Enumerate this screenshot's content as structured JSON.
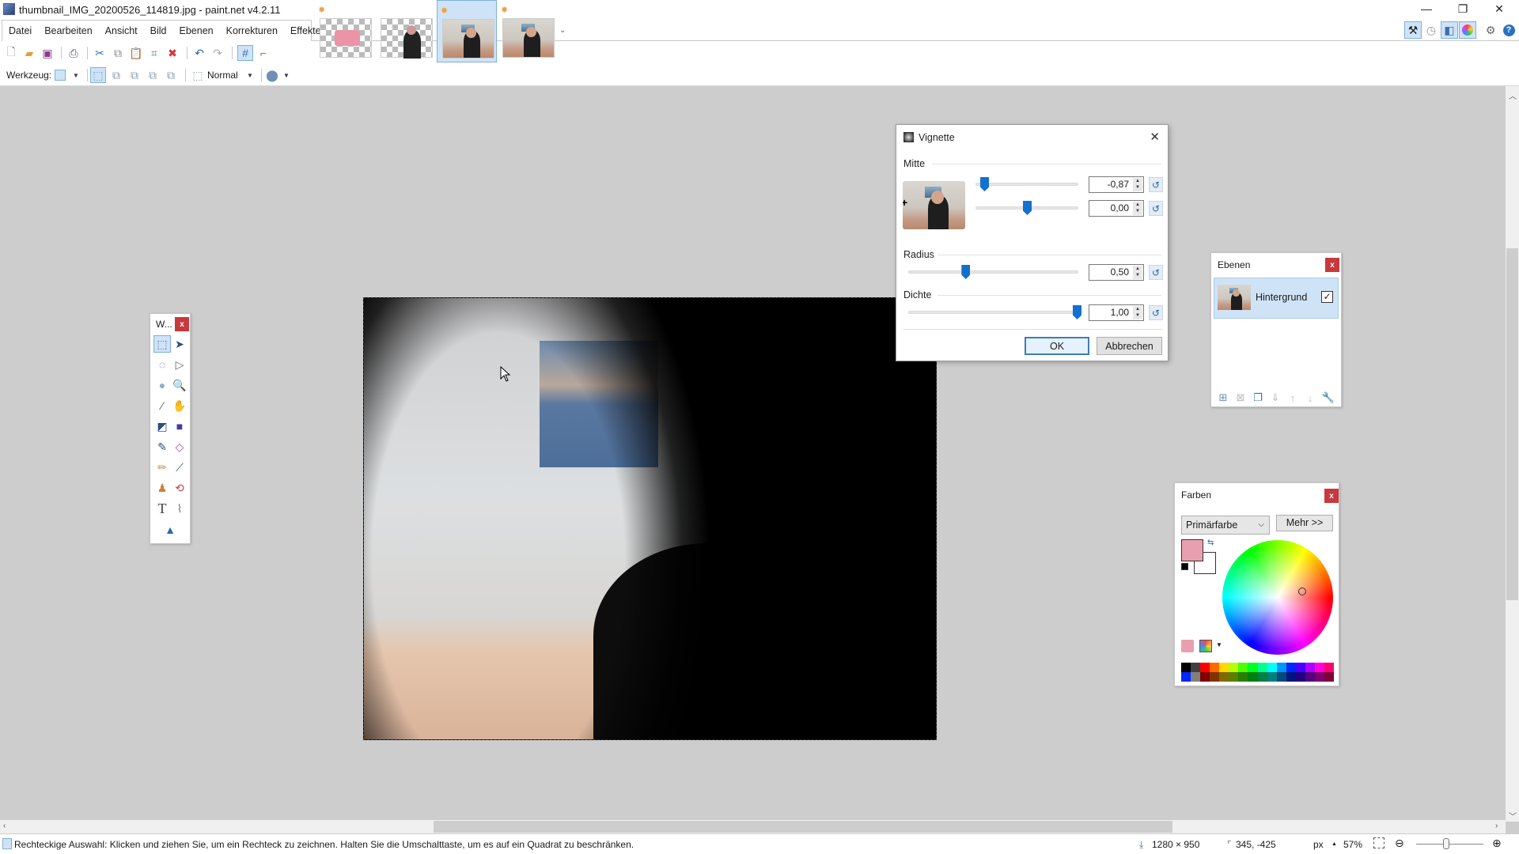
{
  "window": {
    "title": "thumbnail_IMG_20200526_114819.jpg - paint.net v4.2.11",
    "minimize_glyph": "—",
    "maximize_glyph": "❐",
    "close_glyph": "✕"
  },
  "menu": [
    "Datei",
    "Bearbeiten",
    "Ansicht",
    "Bild",
    "Ebenen",
    "Korrekturen",
    "Effekte"
  ],
  "image_tabs": [
    {
      "label": "pink rectangle image",
      "modified": true,
      "active": false
    },
    {
      "label": "person transparent image",
      "modified": false,
      "active": false
    },
    {
      "label": "thumbnail_IMG_20200526_114819.jpg",
      "modified": true,
      "active": true
    },
    {
      "label": "photo image",
      "modified": true,
      "active": false
    }
  ],
  "top_right_icons": [
    "tools-icon",
    "history-icon",
    "layers-icon",
    "colors-icon",
    "settings-icon",
    "help-icon"
  ],
  "toolbar": {
    "tool_label": "Werkzeug:",
    "blend_mode": "Normal"
  },
  "tools_window": {
    "title": "W...",
    "close": "x"
  },
  "vignette": {
    "title": "Vignette",
    "close": "✕",
    "sections": {
      "center": "Mitte",
      "radius": "Radius",
      "density": "Dichte"
    },
    "center_x": {
      "value": "-0,87",
      "fraction": 0.065
    },
    "center_y": {
      "value": "0,00",
      "fraction": 0.5
    },
    "radius": {
      "value": "0,50",
      "fraction": 0.33
    },
    "density": {
      "value": "1,00",
      "fraction": 1.0
    },
    "ok": "OK",
    "cancel": "Abbrechen"
  },
  "layers": {
    "title": "Ebenen",
    "close": "x",
    "items": [
      {
        "name": "Hintergrund",
        "visible": true,
        "check": "✓"
      }
    ]
  },
  "colors": {
    "title": "Farben",
    "close": "x",
    "selector": "Primärfarbe",
    "more": "Mehr >>",
    "primary": "#e8a0b0",
    "secondary": "#ffffff",
    "palette_top": [
      "#000000",
      "#404040",
      "#ff0000",
      "#ff6a00",
      "#ffd800",
      "#b6ff00",
      "#4cff00",
      "#00ff21",
      "#00ff90",
      "#00ffff",
      "#0094ff",
      "#0026ff",
      "#4800ff",
      "#b200ff",
      "#ff00dc",
      "#ff006e"
    ],
    "palette_bottom": [
      "#0026ff",
      "#808080",
      "#7f0000",
      "#7f3300",
      "#7f6a00",
      "#5b7f00",
      "#267f00",
      "#007f0e",
      "#007f46",
      "#007f7f",
      "#004a7f",
      "#00137f",
      "#21007f",
      "#57007f",
      "#7f006e",
      "#7f0037"
    ]
  },
  "statusbar": {
    "hint": "Rechteckige Auswahl: Klicken und ziehen Sie, um ein Rechteck zu zeichnen. Halten Sie die Umschalttaste, um es auf ein Quadrat zu beschränken.",
    "image_size": "1280 × 950",
    "cursor_pos": "345, -425",
    "units": "px",
    "units_arrow": "▲",
    "zoom": "57%"
  }
}
